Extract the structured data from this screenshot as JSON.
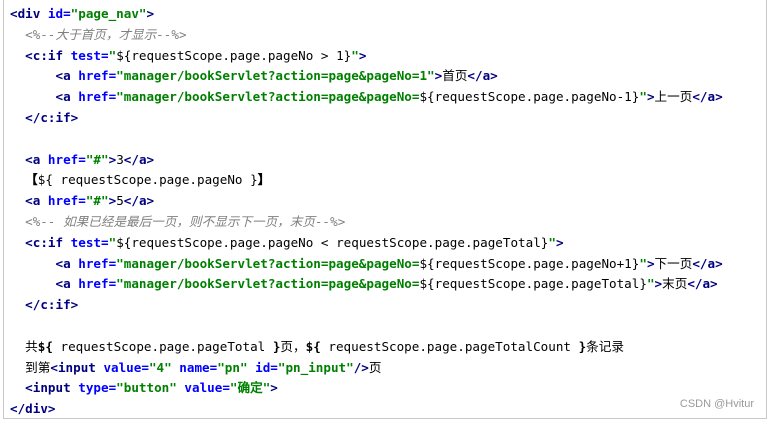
{
  "code": {
    "lines": [
      [
        [
          "tag",
          "<div "
        ],
        [
          "attr",
          "id="
        ],
        [
          "str",
          "\"page_nav\""
        ],
        [
          "tag",
          ">"
        ]
      ],
      [
        [
          "comment",
          "  <%--大于首页，才显示--%>"
        ]
      ],
      [
        [
          "tag",
          "  <c:if "
        ],
        [
          "attr",
          "test="
        ],
        [
          "str",
          "\""
        ],
        [
          "el",
          "${requestScope.page.pageNo > 1}"
        ],
        [
          "str",
          "\""
        ],
        [
          "tag",
          ">"
        ]
      ],
      [
        [
          "tag",
          "      <a "
        ],
        [
          "attr",
          "href="
        ],
        [
          "str",
          "\"manager/bookServlet?action=page&pageNo=1\""
        ],
        [
          "tag",
          ">"
        ],
        [
          "txt",
          "首页"
        ],
        [
          "tag",
          "</a>"
        ]
      ],
      [
        [
          "tag",
          "      <a "
        ],
        [
          "attr",
          "href="
        ],
        [
          "str",
          "\"manager/bookServlet?action=page&pageNo="
        ],
        [
          "el",
          "${requestScope.page.pageNo-1}"
        ],
        [
          "str",
          "\""
        ],
        [
          "tag",
          ">"
        ],
        [
          "txt",
          "上一页"
        ],
        [
          "tag",
          "</a>"
        ]
      ],
      [
        [
          "tag",
          "  </c:if>"
        ]
      ],
      [],
      [
        [
          "tag",
          "  <a "
        ],
        [
          "attr",
          "href="
        ],
        [
          "str",
          "\"#\""
        ],
        [
          "tag",
          ">"
        ],
        [
          "txt",
          "3"
        ],
        [
          "tag",
          "</a>"
        ]
      ],
      [
        [
          "bold",
          "  【"
        ],
        [
          "el",
          "${ requestScope.page.pageNo }"
        ],
        [
          "bold",
          "】"
        ]
      ],
      [
        [
          "tag",
          "  <a "
        ],
        [
          "attr",
          "href="
        ],
        [
          "str",
          "\"#\""
        ],
        [
          "tag",
          ">"
        ],
        [
          "txt",
          "5"
        ],
        [
          "tag",
          "</a>"
        ]
      ],
      [
        [
          "comment",
          "  <%-- 如果已经是最后一页，则不显示下一页，末页--%>"
        ]
      ],
      [
        [
          "tag",
          "  <c:if "
        ],
        [
          "attr",
          "test="
        ],
        [
          "str",
          "\""
        ],
        [
          "el",
          "${requestScope.page.pageNo < requestScope.page.pageTotal}"
        ],
        [
          "str",
          "\""
        ],
        [
          "tag",
          ">"
        ]
      ],
      [
        [
          "tag",
          "      <a "
        ],
        [
          "attr",
          "href="
        ],
        [
          "str",
          "\"manager/bookServlet?action=page&pageNo="
        ],
        [
          "el",
          "${requestScope.page.pageNo+1}"
        ],
        [
          "str",
          "\""
        ],
        [
          "tag",
          ">"
        ],
        [
          "txt",
          "下一页"
        ],
        [
          "tag",
          "</a>"
        ]
      ],
      [
        [
          "tag",
          "      <a "
        ],
        [
          "attr",
          "href="
        ],
        [
          "str",
          "\"manager/bookServlet?action=page&pageNo="
        ],
        [
          "el",
          "${requestScope.page.pageTotal}"
        ],
        [
          "str",
          "\""
        ],
        [
          "tag",
          ">"
        ],
        [
          "txt",
          "末页"
        ],
        [
          "tag",
          "</a>"
        ]
      ],
      [
        [
          "tag",
          "  </c:if>"
        ]
      ],
      [],
      [
        [
          "txt",
          "  共"
        ],
        [
          "bold",
          "${"
        ],
        [
          "el",
          " requestScope.page.pageTotal "
        ],
        [
          "bold",
          "}"
        ],
        [
          "txt",
          "页，"
        ],
        [
          "bold",
          "${"
        ],
        [
          "el",
          " requestScope.page.pageTotalCount "
        ],
        [
          "bold",
          "}"
        ],
        [
          "txt",
          "条记录"
        ]
      ],
      [
        [
          "txt",
          "  到第"
        ],
        [
          "tag",
          "<input "
        ],
        [
          "attr",
          "value="
        ],
        [
          "str",
          "\"4\" "
        ],
        [
          "attr",
          "name="
        ],
        [
          "str",
          "\"pn\" "
        ],
        [
          "attr",
          "id="
        ],
        [
          "str",
          "\"pn_input\""
        ],
        [
          "tag",
          "/>"
        ],
        [
          "txt",
          "页"
        ]
      ],
      [
        [
          "tag",
          "  <input "
        ],
        [
          "attr",
          "type="
        ],
        [
          "str",
          "\"button\" "
        ],
        [
          "attr",
          "value="
        ],
        [
          "str",
          "\"确定\""
        ],
        [
          "tag",
          ">"
        ]
      ],
      [
        [
          "tag",
          "</div>"
        ]
      ]
    ]
  },
  "watermark": "CSDN @Hvitur",
  "colors": {
    "tag": "#000080",
    "attribute": "#0000ff",
    "string": "#008000",
    "comment": "#808080"
  }
}
